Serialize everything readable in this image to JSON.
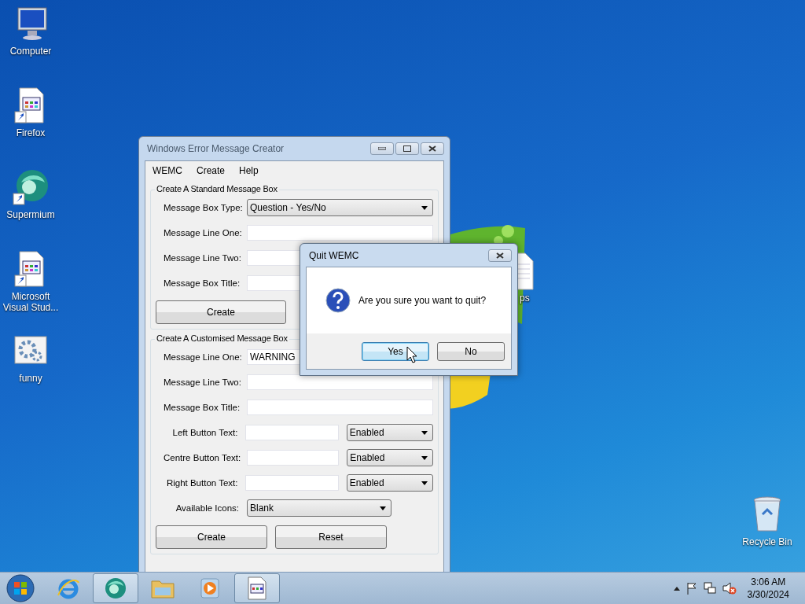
{
  "desktop_icons": [
    {
      "label": "Computer",
      "kind": "computer"
    },
    {
      "label": "Firefox",
      "kind": "shortcut"
    },
    {
      "label": "Supermium",
      "kind": "browser"
    },
    {
      "label": "Microsoft Visual Stud...",
      "kind": "shortcut"
    },
    {
      "label": "funny",
      "kind": "gear"
    }
  ],
  "hidden_icon": {
    "label": "ps"
  },
  "recycle_bin": {
    "label": "Recycle Bin"
  },
  "wemc_window": {
    "title": "Windows Error Message Creator",
    "menu": [
      "WEMC",
      "Create",
      "Help"
    ],
    "standard_group": {
      "title": "Create A Standard Message Box",
      "rows": [
        {
          "label": "Message Box Type:",
          "kind": "select",
          "value": "Question - Yes/No"
        },
        {
          "label": "Message Line One:",
          "kind": "text"
        },
        {
          "label": "Message Line Two:",
          "kind": "text"
        },
        {
          "label": "Message Box Title:",
          "kind": "text"
        }
      ],
      "buttons": [
        "Create"
      ]
    },
    "custom_group": {
      "title": "Create A Customised Message Box",
      "rows": [
        {
          "label": "Message Line One:",
          "kind": "text",
          "value": "WARNING"
        },
        {
          "label": "Message Line Two:",
          "kind": "text"
        },
        {
          "label": "Message Box Title:",
          "kind": "text"
        },
        {
          "label": "Left Button Text:",
          "kind": "text_select",
          "select": "Enabled"
        },
        {
          "label": "Centre Button Text:",
          "kind": "text_select",
          "select": "Enabled"
        },
        {
          "label": "Right Button Text:",
          "kind": "text_select",
          "select": "Enabled"
        },
        {
          "label": "Available Icons:",
          "kind": "short_select",
          "value": "Blank"
        }
      ],
      "buttons": [
        "Create",
        "Reset"
      ]
    }
  },
  "dialog": {
    "title": "Quit WEMC",
    "message": "Are you sure you want to quit?",
    "buttons": [
      {
        "label": "Yes",
        "selected": true
      },
      {
        "label": "No",
        "selected": false
      }
    ]
  },
  "taskbar": {
    "items": [
      {
        "kind": "ie",
        "selected": false
      },
      {
        "kind": "browser",
        "selected": true
      },
      {
        "kind": "folder",
        "selected": false
      },
      {
        "kind": "media",
        "selected": false
      },
      {
        "kind": "app",
        "selected": true
      }
    ],
    "time": "3:06 AM",
    "date": "3/30/2024"
  }
}
